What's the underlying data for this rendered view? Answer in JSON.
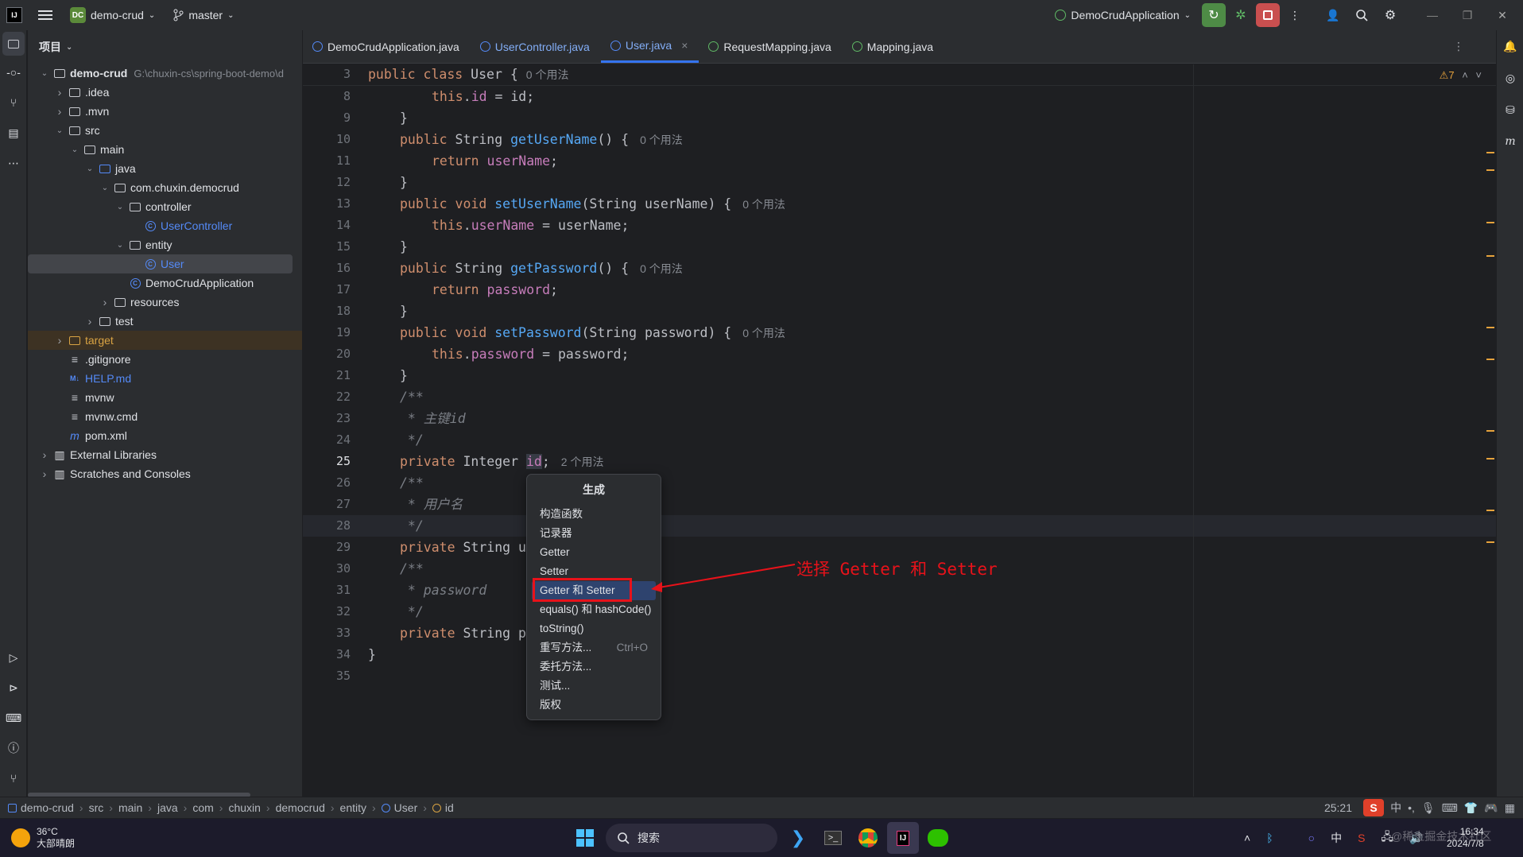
{
  "titlebar": {
    "app_icon": "intellij-logo",
    "project_badge": "DC",
    "project_name": "demo-crud",
    "branch": "master",
    "run_config": "DemoCrudApplication"
  },
  "project_panel": {
    "title": "项目",
    "root_name": "demo-crud",
    "root_path": "G:\\chuxin-cs\\spring-boot-demo\\d",
    "items": [
      {
        "label": ".idea",
        "type": "folder"
      },
      {
        "label": ".mvn",
        "type": "folder"
      },
      {
        "label": "src",
        "type": "folder"
      },
      {
        "label": "main",
        "type": "folder"
      },
      {
        "label": "java",
        "type": "folder"
      },
      {
        "label": "com.chuxin.democrud",
        "type": "package"
      },
      {
        "label": "controller",
        "type": "package"
      },
      {
        "label": "UserController",
        "type": "class"
      },
      {
        "label": "entity",
        "type": "package"
      },
      {
        "label": "User",
        "type": "class"
      },
      {
        "label": "DemoCrudApplication",
        "type": "class"
      },
      {
        "label": "resources",
        "type": "folder"
      },
      {
        "label": "test",
        "type": "folder"
      },
      {
        "label": "target",
        "type": "folder"
      },
      {
        "label": ".gitignore",
        "type": "file"
      },
      {
        "label": "HELP.md",
        "type": "file"
      },
      {
        "label": "mvnw",
        "type": "file"
      },
      {
        "label": "mvnw.cmd",
        "type": "file"
      },
      {
        "label": "pom.xml",
        "type": "file"
      },
      {
        "label": "External Libraries",
        "type": "lib"
      },
      {
        "label": "Scratches and Consoles",
        "type": "lib"
      }
    ]
  },
  "tabs": [
    {
      "label": "DemoCrudApplication.java"
    },
    {
      "label": "UserController.java"
    },
    {
      "label": "User.java",
      "active": true
    },
    {
      "label": "RequestMapping.java"
    },
    {
      "label": "Mapping.java"
    }
  ],
  "editor": {
    "warning_count": "7",
    "sticky": {
      "line": "3",
      "text_kw": "public class ",
      "text_cls": "User",
      "text_brace": " {",
      "hint": "0 个用法"
    },
    "line_numbers": [
      "8",
      "9",
      "10",
      "11",
      "12",
      "13",
      "14",
      "15",
      "16",
      "17",
      "18",
      "19",
      "20",
      "21",
      "22",
      "23",
      "24",
      "25",
      "26",
      "27",
      "28",
      "29",
      "30",
      "31",
      "32",
      "33",
      "34",
      "35"
    ],
    "lines": {
      "l8": {
        "kw": "this",
        "dot": ".",
        "fld": "id",
        "rest": " = id;"
      },
      "l9": "}",
      "l10": {
        "kw": "public ",
        "type": "String ",
        "fn": "getUserName",
        "rest": "() {",
        "hint": "0 个用法"
      },
      "l11": {
        "kw": "return ",
        "fld": "userName",
        "rest": ";"
      },
      "l12": "}",
      "l13": {
        "kw": "public void ",
        "fn": "setUserName",
        "rest": "(String userName) {",
        "hint": "0 个用法"
      },
      "l14": {
        "kw": "this",
        "dot": ".",
        "fld": "userName",
        "rest": " = userName;"
      },
      "l15": "}",
      "l16": {
        "kw": "public ",
        "type": "String ",
        "fn": "getPassword",
        "rest": "() {",
        "hint": "0 个用法"
      },
      "l17": {
        "kw": "return ",
        "fld": "password",
        "rest": ";"
      },
      "l18": "}",
      "l19": {
        "kw": "public void ",
        "fn": "setPassword",
        "rest": "(String password) {",
        "hint": "0 个用法"
      },
      "l20": {
        "kw": "this",
        "dot": ".",
        "fld": "password",
        "rest": " = password;"
      },
      "l21": "}",
      "l22": "/**",
      "l23": " * 主键id",
      "l24": " */",
      "l25": {
        "kw": "private ",
        "type": "Integer ",
        "fld": "id",
        "rest": ";",
        "hint": "2 个用法"
      },
      "l26": "/**",
      "l27": " * 用户名",
      "l28": " */",
      "l29": {
        "kw": "private ",
        "type": "String ",
        "rest": "u"
      },
      "l30": "/**",
      "l31": " * password",
      "l32": " */",
      "l33": {
        "kw": "private ",
        "type": "String ",
        "rest": "p"
      },
      "l34": "}"
    }
  },
  "context_menu": {
    "title": "生成",
    "items": [
      {
        "label": "构造函数"
      },
      {
        "label": "记录器"
      },
      {
        "label": "Getter"
      },
      {
        "label": "Setter"
      },
      {
        "label": "Getter 和 Setter",
        "selected": true
      },
      {
        "label": "equals() 和 hashCode()"
      },
      {
        "label": "toString()"
      },
      {
        "label": "重写方法...",
        "shortcut": "Ctrl+O"
      },
      {
        "label": "委托方法..."
      },
      {
        "label": "测试..."
      },
      {
        "label": "版权"
      }
    ]
  },
  "annotation": {
    "text": "选择 Getter 和 Setter",
    "color": "#e8121a"
  },
  "statusbar": {
    "breadcrumb": [
      "demo-crud",
      "src",
      "main",
      "java",
      "com",
      "chuxin",
      "democrud",
      "entity",
      "User",
      "id"
    ],
    "position": "25:21"
  },
  "taskbar": {
    "weather_temp": "36°C",
    "weather_desc": "大部晴朗",
    "search_placeholder": "搜索",
    "ime": "中",
    "time": "16:34",
    "date": "2024/7/8",
    "watermark": "@稀土掘金技术社区"
  },
  "colors": {
    "accent": "#3574f0",
    "keyword": "#cf8e6d",
    "field": "#c77dbb",
    "method": "#56a8f5",
    "annotation_red": "#e8121a"
  }
}
